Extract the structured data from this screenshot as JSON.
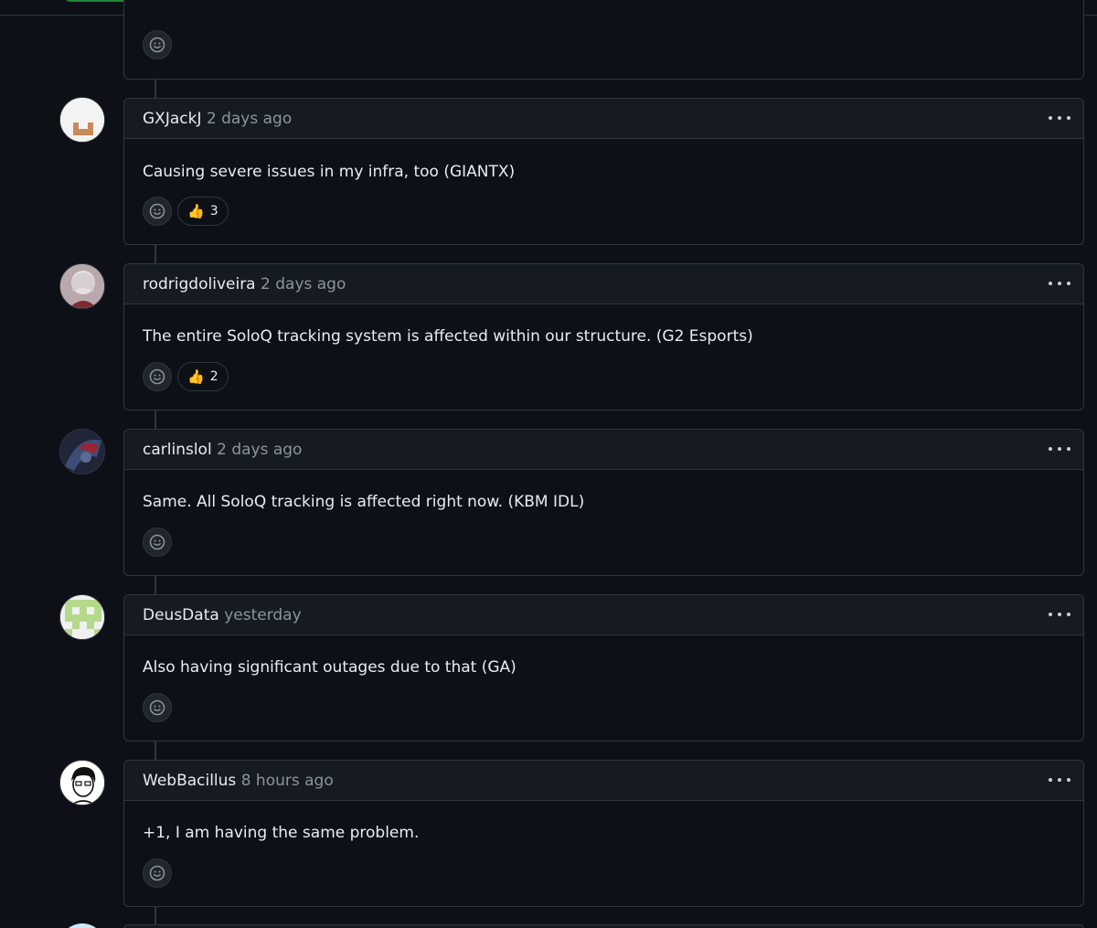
{
  "comments": [
    {
      "author": "GXJackJ",
      "time": "2 days ago",
      "body": "Causing severe issues in my infra, too (GIANTX)",
      "reactions": [
        {
          "emoji": "👍",
          "count": "3"
        }
      ],
      "avatar": "white-bucket-avatar"
    },
    {
      "author": "rodrigdoliveira",
      "time": "2 days ago",
      "body": "The entire SoloQ tracking system is affected within our structure. (G2 Esports)",
      "reactions": [
        {
          "emoji": "👍",
          "count": "2"
        }
      ],
      "avatar": "anime-avatar"
    },
    {
      "author": "carlinslol",
      "time": "2 days ago",
      "body": "Same. All SoloQ tracking is affected right now. (KBM IDL)",
      "reactions": [],
      "avatar": "dark-character-avatar"
    },
    {
      "author": "DeusData",
      "time": "yesterday",
      "body": "Also having significant outages due to that (GA)",
      "reactions": [],
      "avatar": "identicon-avatar"
    },
    {
      "author": "WebBacillus",
      "time": "8 hours ago",
      "body": "+1, I am having the same problem.",
      "reactions": [],
      "avatar": "cartoon-face-avatar"
    }
  ],
  "icons": {
    "emoji_picker": "smiley-icon",
    "more": "kebab-icon"
  },
  "colors": {
    "background": "#0d1117",
    "header": "#161b22",
    "border": "#30363d",
    "muted": "#8b949e"
  }
}
